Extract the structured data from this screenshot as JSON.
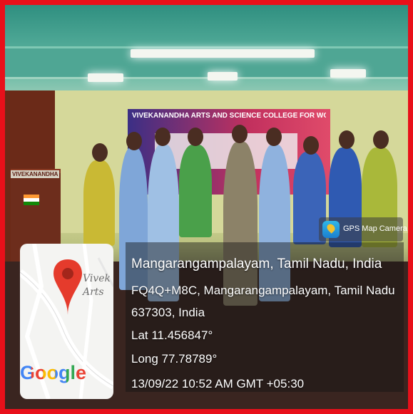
{
  "photo": {
    "banner_title": "VIVEKANANDHA ARTS AND SCIENCE COLLEGE FOR WOMEN",
    "podium_label": "VIVEKANANDHA"
  },
  "gps_badge": {
    "label": "GPS Map Camera",
    "icon": "camera-icon"
  },
  "map_card": {
    "place_text": "Vivek Arts",
    "brand": "Google",
    "pin_icon": "map-pin-icon"
  },
  "location": {
    "title": "Mangarangampalayam, Tamil Nadu, India",
    "address_line1": "FQ4Q+M8C, Mangarangampalayam, Tamil Nadu",
    "address_line2": "637303, India",
    "lat": "Lat 11.456847°",
    "long": "Long 77.78789°",
    "datetime": "13/09/22 10:52 AM GMT +05:30"
  },
  "colors": {
    "frame": "#e8101a",
    "brand_blue": "#4285f4",
    "brand_red": "#ea4335",
    "brand_yellow": "#fbbc05",
    "brand_green": "#34a853"
  }
}
